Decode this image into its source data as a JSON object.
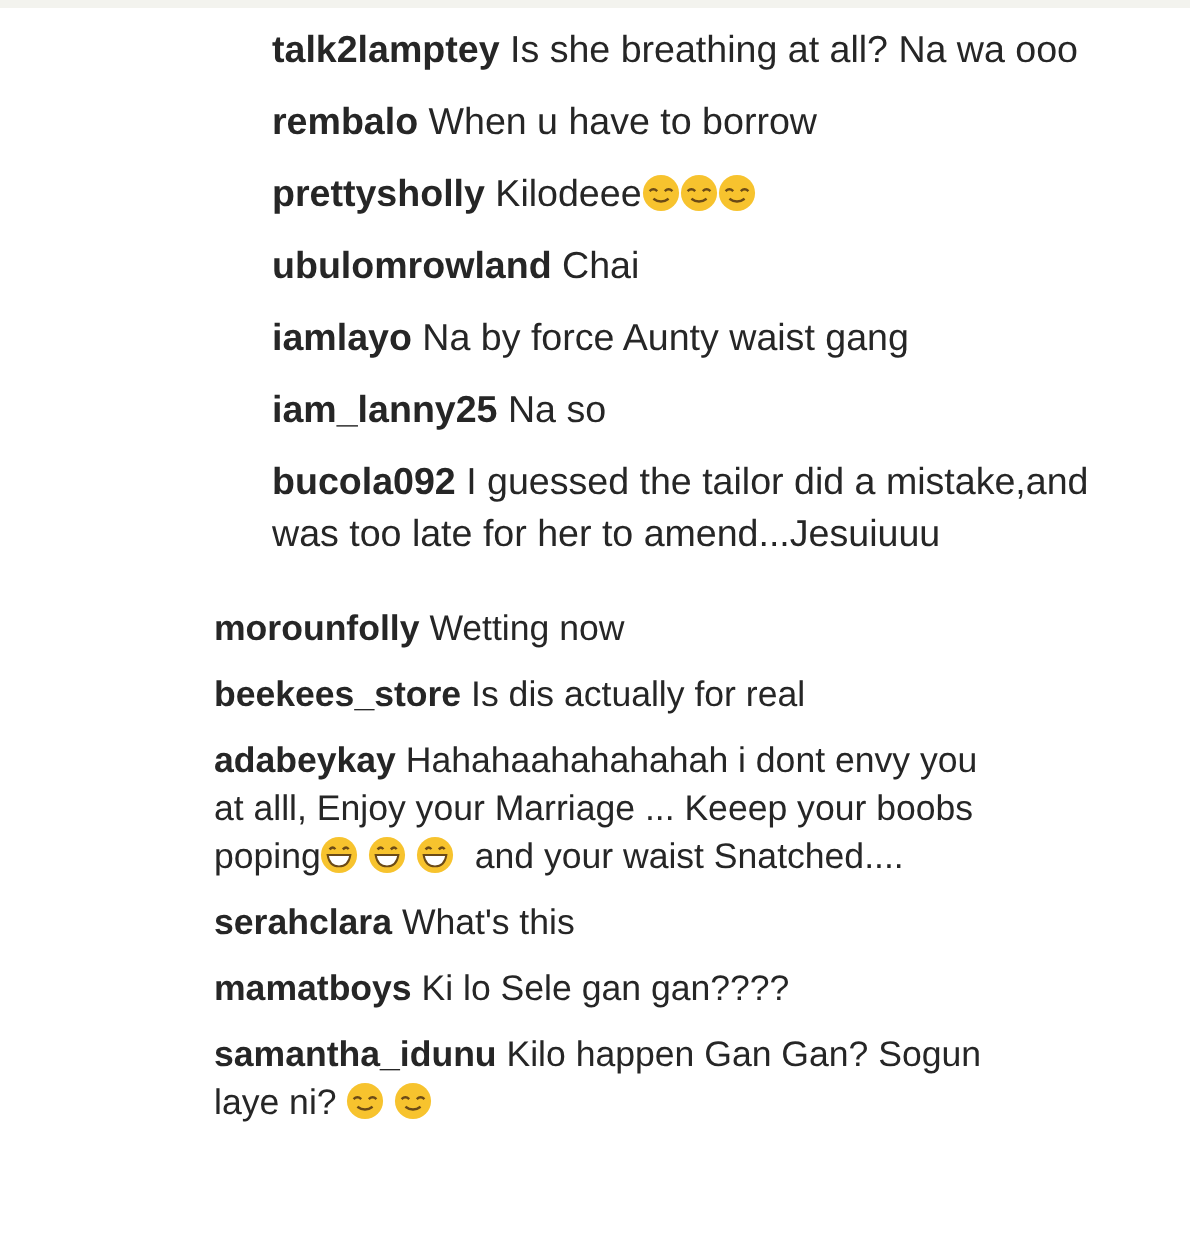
{
  "groups": [
    {
      "comments": [
        {
          "user": "talk2lamptey",
          "parts": [
            {
              "kind": "text",
              "text": "Is she breathing at all? Na wa ooo"
            }
          ]
        },
        {
          "user": "rembalo",
          "parts": [
            {
              "kind": "text",
              "text": "When u have to borrow"
            }
          ]
        },
        {
          "user": "prettysholly",
          "parts": [
            {
              "kind": "text",
              "text": "Kilodeee"
            },
            {
              "kind": "smile"
            },
            {
              "kind": "smile"
            },
            {
              "kind": "smile"
            }
          ]
        },
        {
          "user": "ubulomrowland",
          "parts": [
            {
              "kind": "text",
              "text": "Chai"
            }
          ]
        },
        {
          "user": "iamlayo",
          "parts": [
            {
              "kind": "text",
              "text": "Na by force Aunty waist gang"
            }
          ]
        },
        {
          "user": "iam_lanny25",
          "parts": [
            {
              "kind": "text",
              "text": "Na so"
            }
          ]
        },
        {
          "user": "bucola092",
          "parts": [
            {
              "kind": "text",
              "text": "I guessed the tailor did a mistake,and was too late for her to amend...Jesuiuuu"
            }
          ]
        }
      ]
    },
    {
      "comments": [
        {
          "user": "morounfolly",
          "parts": [
            {
              "kind": "text",
              "text": "Wetting now"
            }
          ]
        },
        {
          "user": "beekees_store",
          "parts": [
            {
              "kind": "text",
              "text": "Is dis actually for real"
            }
          ]
        },
        {
          "user": "adabeykay",
          "parts": [
            {
              "kind": "text",
              "text": "Hahahaahahahahah i dont envy you at alll, Enjoy your Marriage ... Keeep your boobs poping"
            },
            {
              "kind": "grin"
            },
            {
              "kind": "grin"
            },
            {
              "kind": "grin"
            },
            {
              "kind": "text",
              "text": " and your waist Snatched...."
            }
          ]
        },
        {
          "user": "serahclara",
          "parts": [
            {
              "kind": "text",
              "text": "What's this"
            }
          ]
        },
        {
          "user": "mamatboys",
          "parts": [
            {
              "kind": "text",
              "text": "Ki lo Sele gan gan????"
            }
          ]
        },
        {
          "user": "samantha_idunu",
          "parts": [
            {
              "kind": "text",
              "text": "Kilo happen Gan Gan? Sogun laye ni? "
            },
            {
              "kind": "smile"
            },
            {
              "kind": "smile"
            }
          ]
        }
      ]
    }
  ]
}
